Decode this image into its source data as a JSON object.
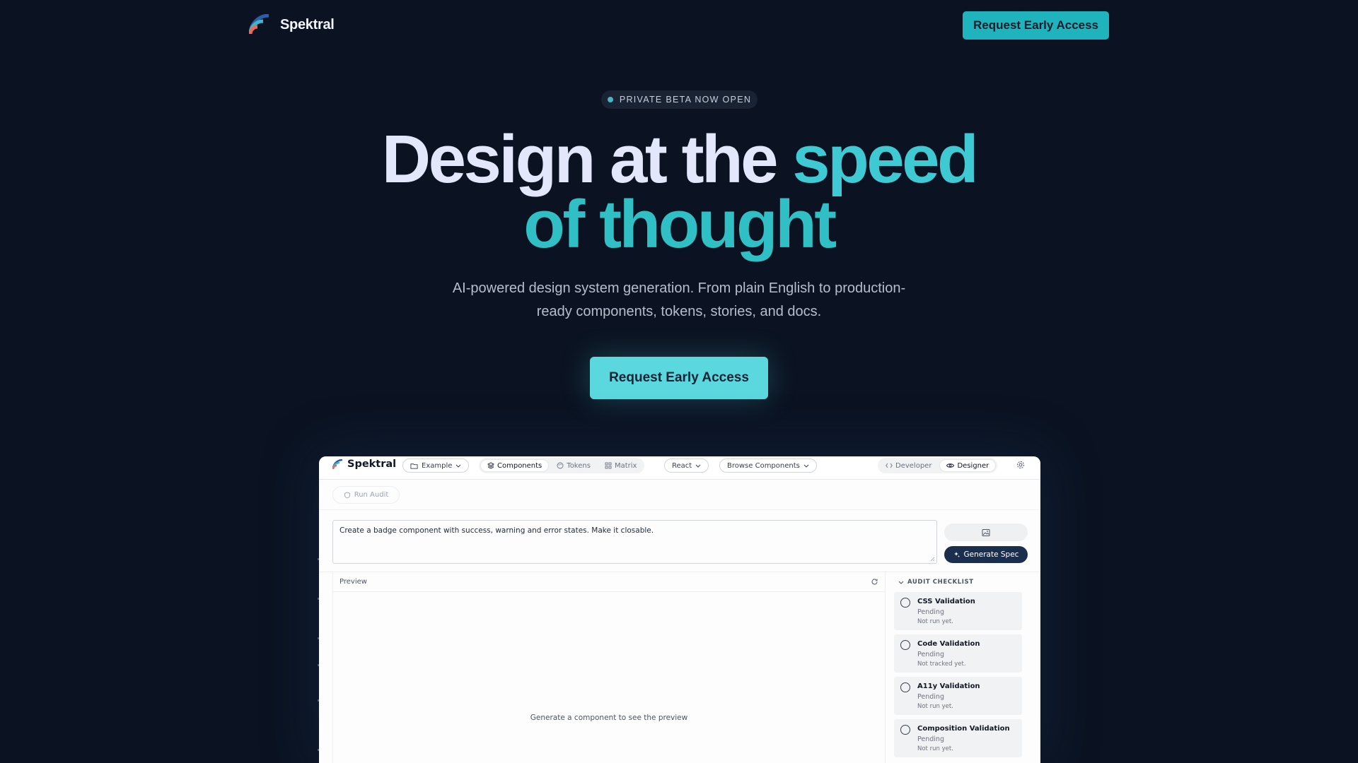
{
  "nav": {
    "brand": "Spektral",
    "cta_label": "Request Early Access"
  },
  "hero": {
    "badge": "PRIVATE BETA NOW OPEN",
    "headline_part1": "Design at the ",
    "headline_part2": "speed",
    "headline_part3": "of thought",
    "subtitle": "AI-powered design system generation. From plain English to production-ready components, tokens, stories, and docs.",
    "cta_label": "Request Early Access"
  },
  "app": {
    "brand": "Spektral",
    "project_select": "Example",
    "tabs": [
      {
        "label": "Components",
        "icon": "layers-icon",
        "active": true
      },
      {
        "label": "Tokens",
        "icon": "palette-icon",
        "active": false
      },
      {
        "label": "Matrix",
        "icon": "grid-icon",
        "active": false
      }
    ],
    "framework_select": "React",
    "browse_select": "Browse Components",
    "modes": [
      {
        "label": "Developer",
        "icon": "code-icon",
        "active": false
      },
      {
        "label": "Designer",
        "icon": "eye-icon",
        "active": true
      }
    ],
    "run_audit_label": "Run Audit",
    "prompt_value": "Create a badge component with success, warning and error states. Make it closable.",
    "generate_label": "Generate Spec",
    "preview_label": "Preview",
    "preview_empty": "Generate a component to see the preview",
    "checklist_title": "AUDIT CHECKLIST",
    "checklist": [
      {
        "title": "CSS Validation",
        "status": "Pending",
        "note": "Not run yet."
      },
      {
        "title": "Code Validation",
        "status": "Pending",
        "note": "Not tracked yet."
      },
      {
        "title": "A11y Validation",
        "status": "Pending",
        "note": "Not run yet."
      },
      {
        "title": "Composition Validation",
        "status": "Pending",
        "note": "Not run yet."
      }
    ]
  },
  "colors": {
    "background": "#0b1322",
    "accent": "#3ec9d3",
    "nav_cta": "#1fb3bd",
    "hero_cta": "#5bd8de",
    "generate_button": "#1b2e4d"
  }
}
